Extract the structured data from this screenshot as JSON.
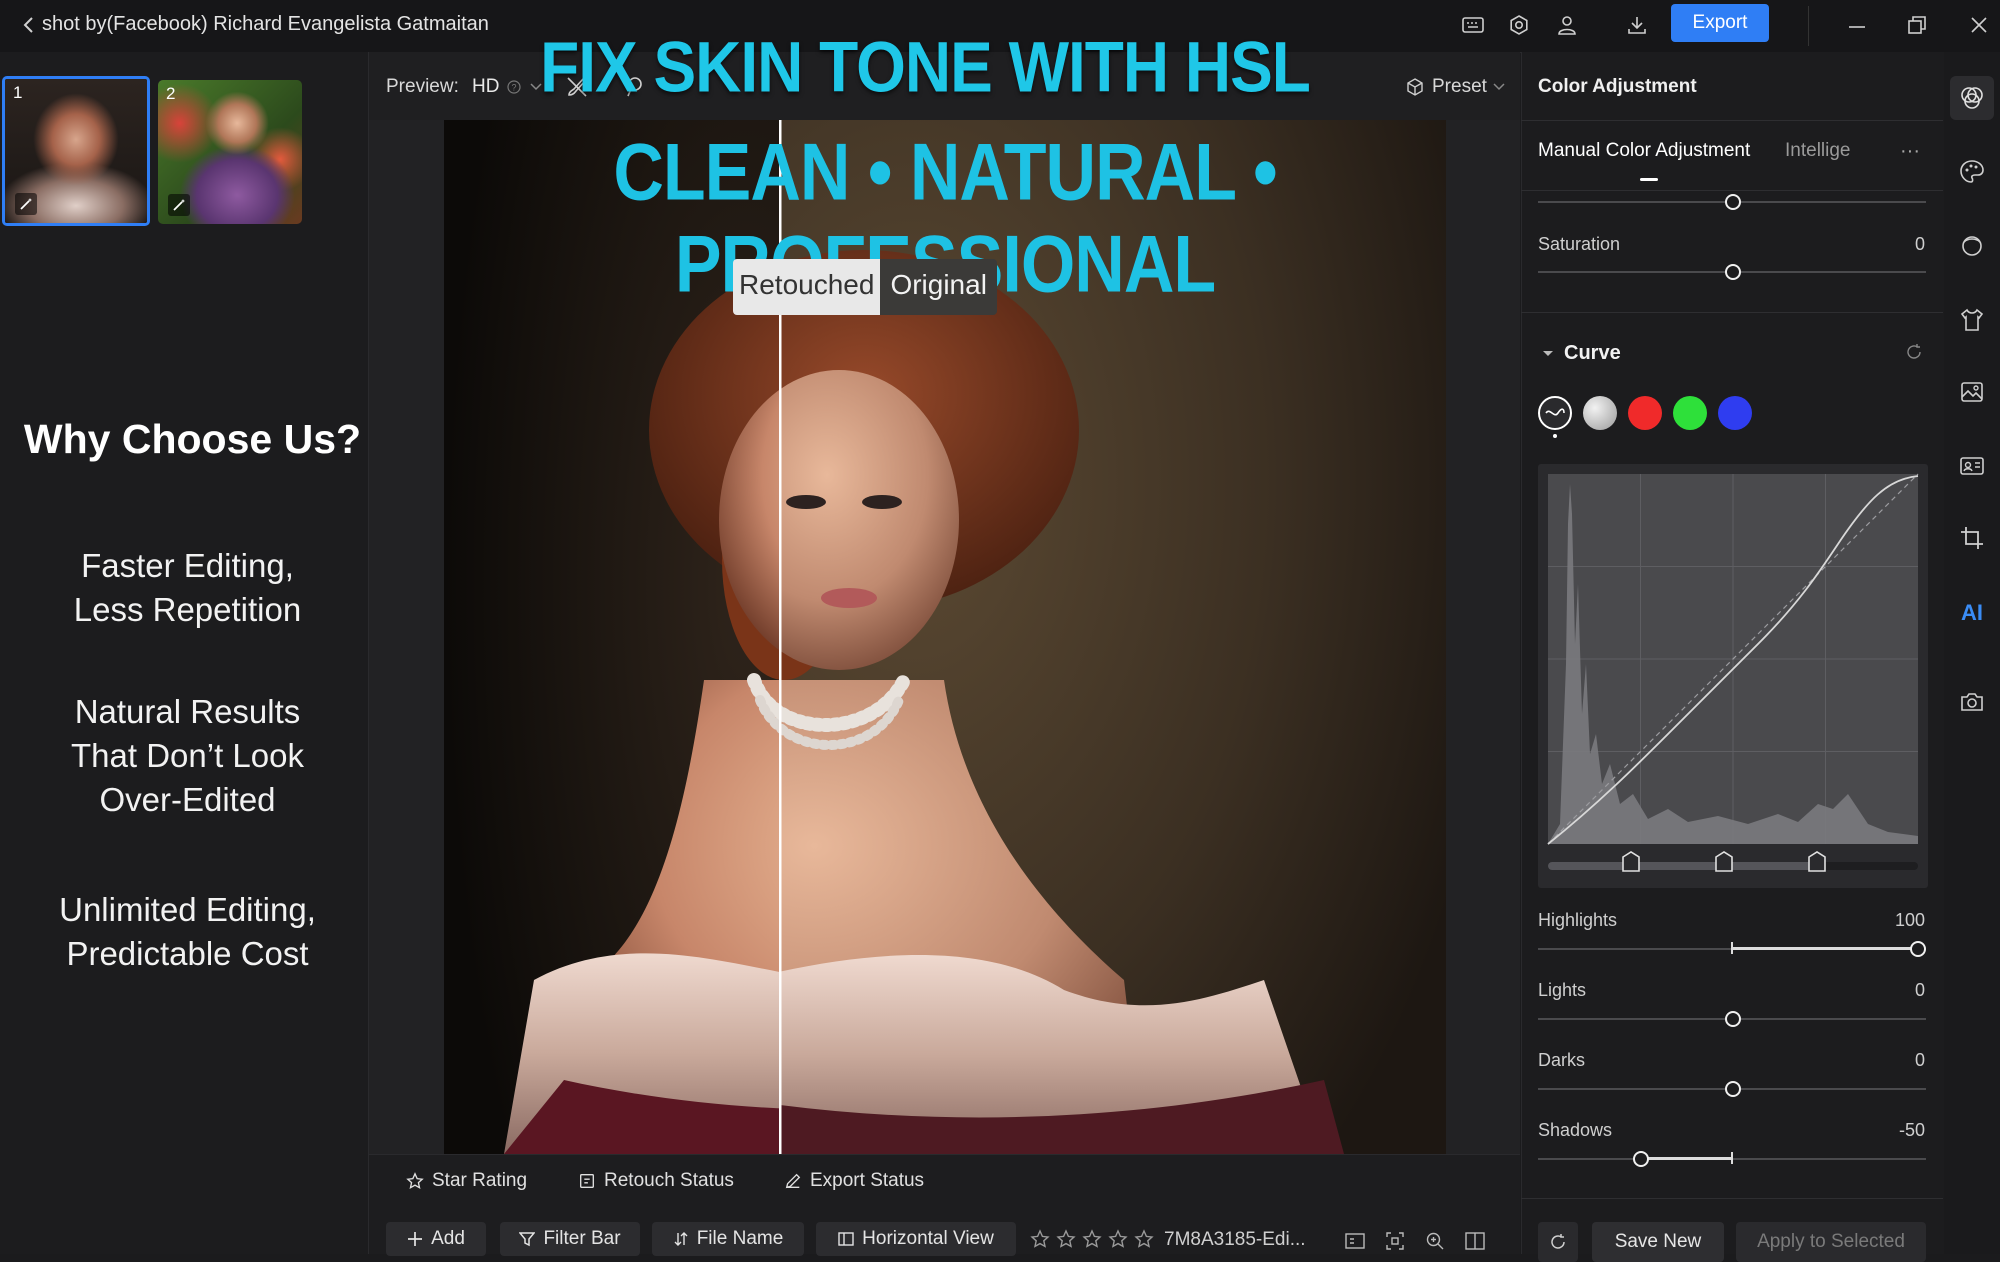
{
  "window": {
    "title": "shot by(Facebook) Richard Evangelista Gatmaitan",
    "export_label": "Export"
  },
  "thumbnails": [
    {
      "number": "1",
      "selected": true
    },
    {
      "number": "2",
      "selected": false
    }
  ],
  "promo": {
    "headline": "FIX SKIN TONE WITH HSL",
    "subheadline": "CLEAN • NATURAL • PROFESSIONAL",
    "why_heading": "Why Choose Us?",
    "features": [
      [
        "Faster Editing,",
        "Less Repetition"
      ],
      [
        "Natural Results",
        "That Don’t Look",
        "Over-Edited"
      ],
      [
        "Unlimited Editing,",
        "Predictable Cost"
      ]
    ]
  },
  "preview_toolbar": {
    "preview_label": "Preview:",
    "preview_value": "HD",
    "preset_label": "Preset"
  },
  "compare": {
    "left_label": "Retouched",
    "right_label": "Original"
  },
  "bottom_bar": {
    "star_rating": "Star Rating",
    "retouch_status": "Retouch Status",
    "export_status": "Export Status",
    "add": "Add",
    "filter_bar": "Filter Bar",
    "file_name": "File Name",
    "horizontal_view": "Horizontal View",
    "file_name_value": "7M8A3185-Edi..."
  },
  "color_panel": {
    "title": "Color Adjustment",
    "tab_manual": "Manual Color Adjustment",
    "tab_intelligent": "Intellige",
    "more": "···",
    "saturation": {
      "label": "Saturation",
      "value": "0"
    },
    "curve_title": "Curve",
    "curve_channels": [
      {
        "name": "rgb-luma",
        "color": "#2a2a2d"
      },
      {
        "name": "luminance",
        "color": "#bdbdbd"
      },
      {
        "name": "red",
        "color": "#f02a2a"
      },
      {
        "name": "green",
        "color": "#2ee03a"
      },
      {
        "name": "blue",
        "color": "#2f3df0"
      }
    ],
    "highlights": {
      "label": "Highlights",
      "value": "100"
    },
    "lights": {
      "label": "Lights",
      "value": "0"
    },
    "darks": {
      "label": "Darks",
      "value": "0"
    },
    "shadows": {
      "label": "Shadows",
      "value": "-50"
    },
    "save_new": "Save New",
    "apply_to_selected": "Apply to Selected"
  },
  "colors": {
    "accent_blue": "#2f7ef5",
    "headline_cyan": "#1fc7e8"
  },
  "tools": [
    "color-adjust-icon",
    "palette-icon",
    "face-retouch-icon",
    "clothing-icon",
    "background-icon",
    "id-card-icon",
    "crop-icon",
    "ai-icon",
    "camera-icon"
  ]
}
